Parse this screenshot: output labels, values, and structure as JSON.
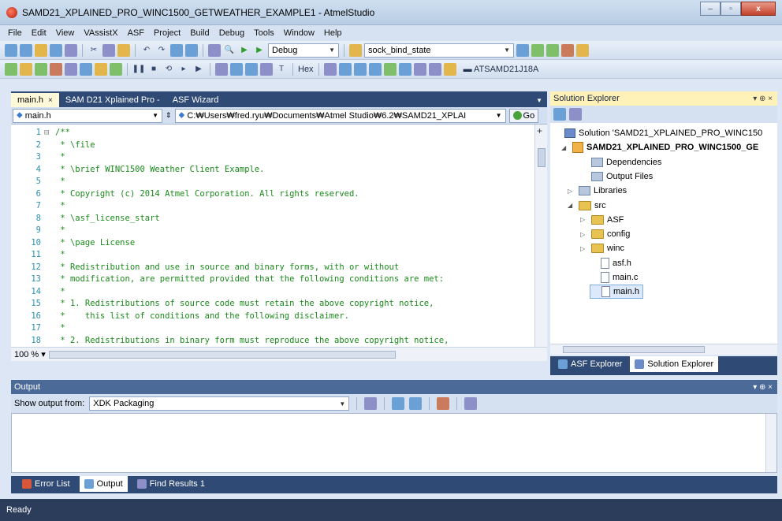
{
  "window": {
    "title": "SAMD21_XPLAINED_PRO_WINC1500_GETWEATHER_EXAMPLE1 - AtmelStudio",
    "controls": [
      "–",
      "▫",
      "x"
    ]
  },
  "menu": [
    "File",
    "Edit",
    "View",
    "VAssistX",
    "ASF",
    "Project",
    "Build",
    "Debug",
    "Tools",
    "Window",
    "Help"
  ],
  "toolbar": {
    "config": "Debug",
    "find_text": "sock_bind_state",
    "hex_label": "Hex",
    "device": "ATSAMD21J18A"
  },
  "editor": {
    "tabs": [
      {
        "label": "main.h",
        "close": "×"
      },
      {
        "label": "SAM D21 Xplained Pro -"
      },
      {
        "label": "ASF Wizard"
      }
    ],
    "nav_symbol": "main.h",
    "nav_path": "C:₩Users₩fred.ryu₩Documents₩Atmel Studio₩6.2₩SAMD21_XPLAI",
    "go_label": "Go",
    "zoom": "100 %",
    "lines": [
      {
        "n": "1",
        "fold": "⊟",
        "text": "/**"
      },
      {
        "n": "2",
        "text": " * \\file"
      },
      {
        "n": "3",
        "text": " *"
      },
      {
        "n": "4",
        "text": " * \\brief WINC1500 Weather Client Example."
      },
      {
        "n": "5",
        "text": " *"
      },
      {
        "n": "6",
        "text": " * Copyright (c) 2014 Atmel Corporation. All rights reserved."
      },
      {
        "n": "7",
        "text": " *"
      },
      {
        "n": "8",
        "text": " * \\asf_license_start"
      },
      {
        "n": "9",
        "text": " *"
      },
      {
        "n": "10",
        "text": " * \\page License"
      },
      {
        "n": "11",
        "text": " *"
      },
      {
        "n": "12",
        "text": " * Redistribution and use in source and binary forms, with or without"
      },
      {
        "n": "13",
        "text": " * modification, are permitted provided that the following conditions are met:"
      },
      {
        "n": "14",
        "text": " *"
      },
      {
        "n": "15",
        "text": " * 1. Redistributions of source code must retain the above copyright notice,"
      },
      {
        "n": "16",
        "text": " *    this list of conditions and the following disclaimer."
      },
      {
        "n": "17",
        "text": " *"
      },
      {
        "n": "18",
        "text": " * 2. Redistributions in binary form must reproduce the above copyright notice,"
      }
    ]
  },
  "solution_explorer": {
    "title": "Solution Explorer",
    "pin": "▾ ⊕ ×",
    "tree": [
      {
        "label": "Solution 'SAMD21_XPLAINED_PRO_WINC150",
        "icon": "sol",
        "exp": ""
      },
      {
        "label": "SAMD21_XPLAINED_PRO_WINC1500_GE",
        "icon": "proj",
        "exp": "◢",
        "bold": true
      },
      {
        "label": "Dependencies",
        "icon": "ref",
        "exp": ""
      },
      {
        "label": "Output Files",
        "icon": "ref",
        "exp": ""
      },
      {
        "label": "Libraries",
        "icon": "ref",
        "exp": "▷"
      },
      {
        "label": "src",
        "icon": "folder",
        "exp": "◢"
      },
      {
        "label": "ASF",
        "icon": "folder",
        "exp": "▷"
      },
      {
        "label": "config",
        "icon": "folder",
        "exp": "▷"
      },
      {
        "label": "winc",
        "icon": "folder",
        "exp": "▷"
      },
      {
        "label": "asf.h",
        "icon": "file",
        "exp": ""
      },
      {
        "label": "main.c",
        "icon": "file",
        "exp": ""
      },
      {
        "label": "main.h",
        "icon": "file",
        "exp": "",
        "selected": true
      }
    ],
    "tabs": [
      "ASF Explorer",
      "Solution Explorer"
    ]
  },
  "output": {
    "title": "Output",
    "pin": "▾ ⊕ ×",
    "show_from_label": "Show output from:",
    "source": "XDK Packaging",
    "bottom_tabs": [
      "Error List",
      "Output",
      "Find Results 1"
    ]
  },
  "status": {
    "text": "Ready"
  },
  "colors": {
    "accent": "#2f4a74",
    "active_tab": "#fff9d9",
    "comment_green": "#1a8a1a",
    "line_number": "#2b91af"
  }
}
